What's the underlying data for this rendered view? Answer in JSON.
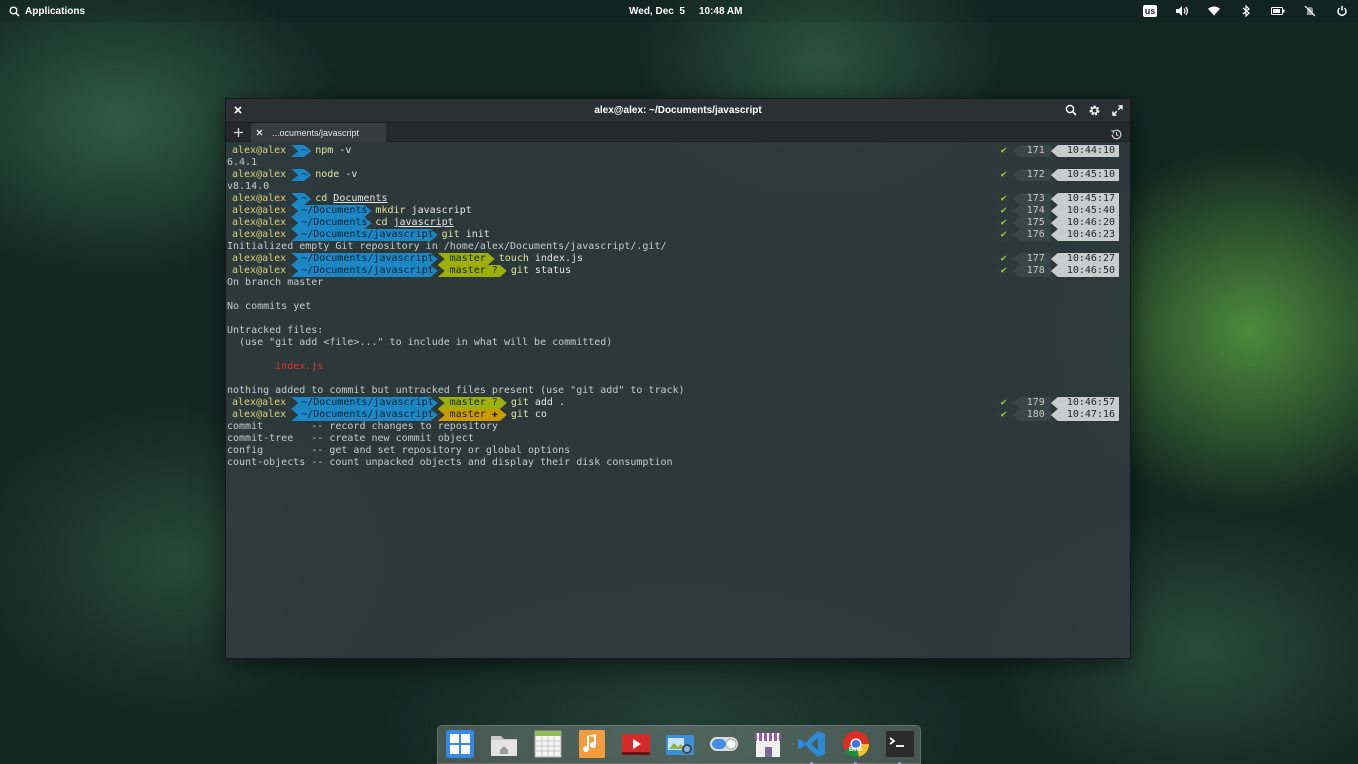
{
  "panel": {
    "applications_label": "Applications",
    "date": "Wed, Dec  5",
    "time": "10:48 AM",
    "keyboard_layout": "us",
    "tray_icons": [
      "keyboard-layout-icon",
      "volume-icon",
      "wifi-icon",
      "bluetooth-icon",
      "battery-icon",
      "notifications-off-icon",
      "power-icon"
    ]
  },
  "window": {
    "title": "alex@alex: ~/Documents/javascript",
    "tab_label": "...ocuments/javascript"
  },
  "terminal": {
    "lines": [
      {
        "type": "prompt",
        "user": "alex@alex",
        "dir": "~",
        "cmd": "npm",
        "arg": " -v",
        "status": "✔",
        "num": "171",
        "time": "10:44:10"
      },
      {
        "type": "out",
        "text": "6.4.1"
      },
      {
        "type": "prompt",
        "user": "alex@alex",
        "dir": "~",
        "cmd": "node",
        "arg": " -v",
        "status": "✔",
        "num": "172",
        "time": "10:45:10"
      },
      {
        "type": "out",
        "text": "v8.14.0"
      },
      {
        "type": "prompt",
        "user": "alex@alex",
        "dir": "~",
        "cmd": "cd",
        "arg": "Documents",
        "underline": true,
        "status": "✔",
        "num": "173",
        "time": "10:45:17"
      },
      {
        "type": "prompt",
        "user": "alex@alex",
        "dir": "~/Documents",
        "cmd": "mkdir",
        "arg": " javascript",
        "status": "✔",
        "num": "174",
        "time": "10:45:40"
      },
      {
        "type": "prompt",
        "user": "alex@alex",
        "dir": "~/Documents",
        "cmd": "cd",
        "arg": "javascript",
        "underline": true,
        "status": "✔",
        "num": "175",
        "time": "10:46:20"
      },
      {
        "type": "prompt",
        "user": "alex@alex",
        "dir": "~/Documents/javascript",
        "cmd": "git",
        "arg": " init",
        "status": "✔",
        "num": "176",
        "time": "10:46:23"
      },
      {
        "type": "out",
        "text": "Initialized empty Git repository in /home/alex/Documents/javascript/.git/"
      },
      {
        "type": "prompt",
        "user": "alex@alex",
        "dir": "~/Documents/javascript",
        "git": "master",
        "git_state": "clean",
        "cmd": "touch",
        "arg": " index.js",
        "status": "✔",
        "num": "177",
        "time": "10:46:27"
      },
      {
        "type": "prompt",
        "user": "alex@alex",
        "dir": "~/Documents/javascript",
        "git": "master ?",
        "git_state": "clean",
        "cmd": "git",
        "arg": " status",
        "status": "✔",
        "num": "178",
        "time": "10:46:50"
      },
      {
        "type": "out",
        "text": "On branch master"
      },
      {
        "type": "out",
        "text": ""
      },
      {
        "type": "out",
        "text": "No commits yet"
      },
      {
        "type": "out",
        "text": ""
      },
      {
        "type": "out",
        "text": "Untracked files:"
      },
      {
        "type": "out",
        "text": "  (use \"git add <file>...\" to include in what will be committed)"
      },
      {
        "type": "out",
        "text": ""
      },
      {
        "type": "out",
        "text": "        index.js",
        "red": true
      },
      {
        "type": "out",
        "text": ""
      },
      {
        "type": "out",
        "text": "nothing added to commit but untracked files present (use \"git add\" to track)"
      },
      {
        "type": "prompt",
        "user": "alex@alex",
        "dir": "~/Documents/javascript",
        "git": "master ?",
        "git_state": "clean",
        "cmd": "git",
        "arg": " add .",
        "status": "✔",
        "num": "179",
        "time": "10:46:57"
      },
      {
        "type": "prompt",
        "user": "alex@alex",
        "dir": "~/Documents/javascript",
        "git": "master ✚",
        "git_state": "staged",
        "cmd": "git",
        "arg": " co",
        "status": "✔",
        "num": "180",
        "time": "10:47:16"
      },
      {
        "type": "out",
        "text": "commit        -- record changes to repository"
      },
      {
        "type": "out",
        "text": "commit-tree   -- create new commit object"
      },
      {
        "type": "out",
        "text": "config        -- get and set repository or global options"
      },
      {
        "type": "out",
        "text": "count-objects -- count unpacked objects and display their disk consumption"
      }
    ]
  },
  "dock": {
    "items": [
      {
        "name": "multitasking-view-icon",
        "running": false
      },
      {
        "name": "files-icon",
        "running": false
      },
      {
        "name": "calendar-icon",
        "running": false
      },
      {
        "name": "music-icon",
        "running": false
      },
      {
        "name": "videos-icon",
        "running": false
      },
      {
        "name": "photos-icon",
        "running": false
      },
      {
        "name": "system-settings-icon",
        "running": false
      },
      {
        "name": "appcenter-icon",
        "running": false
      },
      {
        "name": "vscode-icon",
        "running": true
      },
      {
        "name": "chrome-beta-icon",
        "running": true,
        "badge": "Beta"
      },
      {
        "name": "terminal-icon",
        "running": true
      }
    ]
  }
}
